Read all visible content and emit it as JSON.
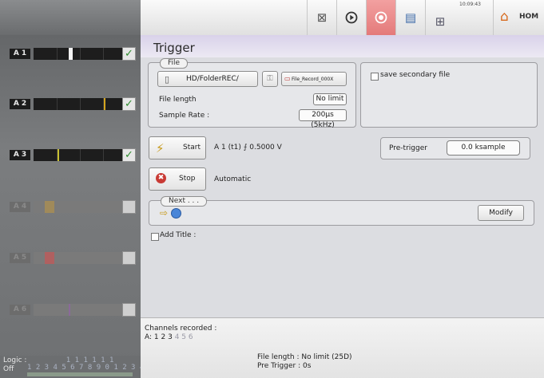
{
  "channels": [
    {
      "tag": "A 1",
      "active": true
    },
    {
      "tag": "A 2",
      "active": true
    },
    {
      "tag": "A 3",
      "active": true
    },
    {
      "tag": "A 4",
      "active": false
    },
    {
      "tag": "A 5",
      "active": false
    },
    {
      "tag": "A 6",
      "active": false
    }
  ],
  "logic": {
    "label_line1": "Logic :",
    "label_line2": "Off",
    "numbers_top": "         1 1 1 1 1 1",
    "numbers_bottom": "1 2 3 4 5 6 7 8 9 0 1 2 3 4 5 6"
  },
  "toolbar": {
    "clock": "10:09:43",
    "home_label": "HOM"
  },
  "trigger": {
    "title": "Trigger",
    "file": {
      "legend": "File",
      "folder": "HD/FolderREC/",
      "filename": "File_Record_000X",
      "length_label": "File length",
      "length_value": "No limit",
      "rate_label": "Sample Rate :",
      "rate_value": "200µs (5kHz)"
    },
    "secondary": "save secondary file",
    "start": {
      "label": "Start",
      "condition": "A 1 (t1) ⨍ 0.5000 V"
    },
    "pretrigger": {
      "label": "Pre-trigger",
      "value": "0.0 ksample"
    },
    "stop": {
      "label": "Stop",
      "mode": "Automatic"
    },
    "next": {
      "legend": "Next . . .",
      "modify": "Modify"
    },
    "add_title": "Add Title :"
  },
  "status": {
    "channels_label": "Channels recorded :",
    "channels_prefix": "A:",
    "channels_active": "1 2 3",
    "channels_inactive": "4 5 6",
    "file_length": "File length    : No limit (25D)",
    "pre_trigger": "Pre Trigger  : 0s"
  },
  "colors": {
    "accent_purple": "#d9d2ea",
    "record": "#e47a7a",
    "check_green": "#2e8b2e"
  }
}
